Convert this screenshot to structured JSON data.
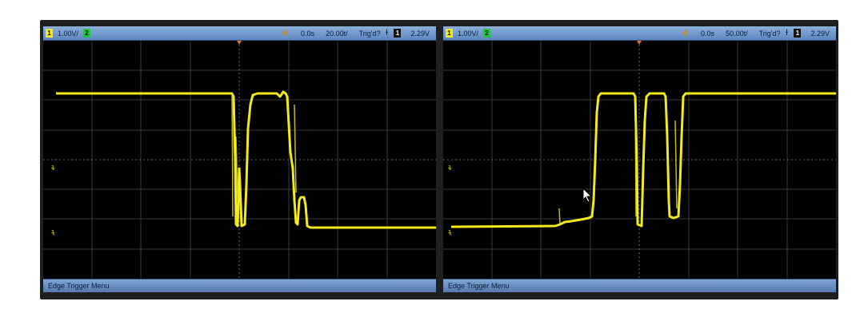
{
  "screens": [
    {
      "id": "left",
      "scale": "1.00V/",
      "delay": "0.0s",
      "timebase": "20.00t/",
      "trigger_status": "Trig'd?",
      "trigger_level": "2.29V",
      "softkey_label": "Edge Trigger Menu",
      "trace_color": "#f2ea1d"
    },
    {
      "id": "right",
      "scale": "1.00V/",
      "delay": "0.0s",
      "timebase": "50.00t/",
      "trigger_status": "Trig'd?",
      "trigger_level": "2.29V",
      "softkey_label": "Edge Trigger Menu",
      "trace_color": "#f2ea1d"
    }
  ],
  "channel_labels": {
    "ch1": "1",
    "ch2": "2"
  },
  "icons": {
    "intensity": "sun-icon",
    "slope": "rising-edge-icon",
    "cursor": "mouse-pointer-icon"
  }
}
